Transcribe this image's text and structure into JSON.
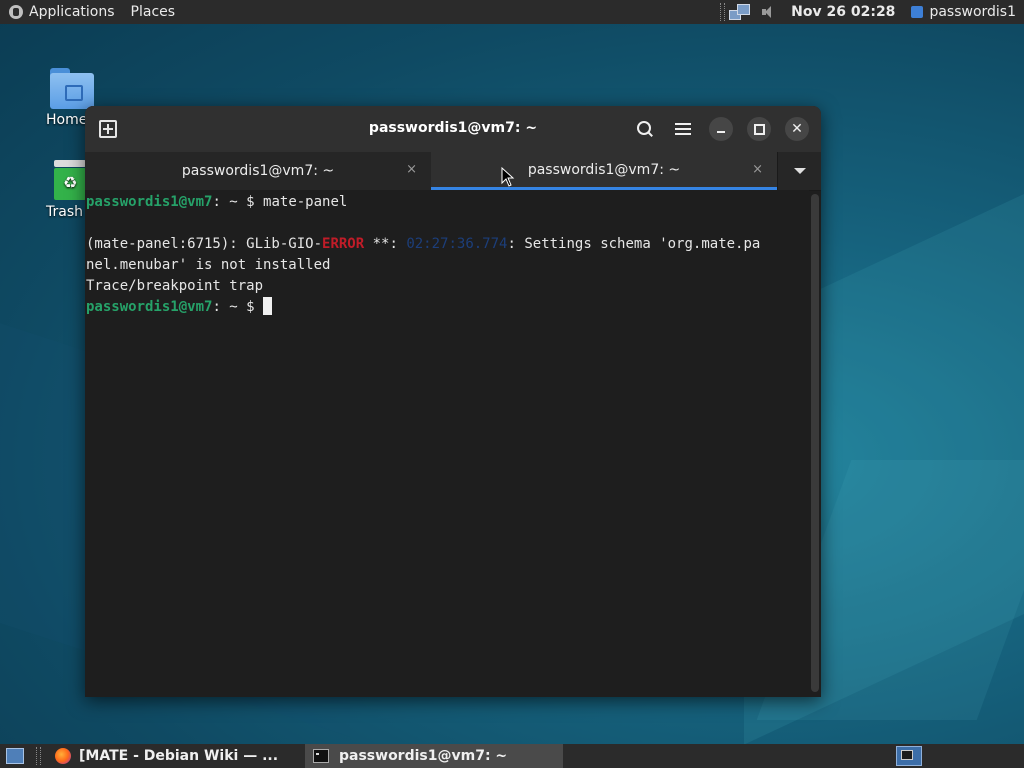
{
  "top_panel": {
    "applications_label": "Applications",
    "places_label": "Places",
    "clock": "Nov 26 02:28",
    "user": "passwordis1"
  },
  "desktop": {
    "icons": [
      {
        "label": "Home",
        "icon": "home-folder-icon"
      },
      {
        "label": "Trash",
        "icon": "trash-icon"
      }
    ]
  },
  "window": {
    "title": "passwordis1@vm7: ~",
    "tabs": [
      {
        "label": "passwordis1@vm7: ~",
        "active": false
      },
      {
        "label": "passwordis1@vm7: ~",
        "active": true
      }
    ],
    "tab_close_glyph": "×",
    "terminal": {
      "prompt_user": "passwordis1@vm7",
      "prompt_sep": ":",
      "prompt_path": " ~ $ ",
      "command": "mate-panel",
      "error_prefix": "(mate-panel:6715): GLib-GIO-",
      "error_word": "ERROR",
      "error_stars": " **: ",
      "error_timestamp": "02:27:36.774",
      "error_msg_1": ": Settings schema 'org.mate.pa",
      "error_msg_2": "nel.menubar' is not installed",
      "trace": "Trace/breakpoint trap"
    }
  },
  "taskbar": {
    "tasks": [
      {
        "label": "[MATE - Debian Wiki — ...",
        "icon": "firefox-icon"
      },
      {
        "label": "passwordis1@vm7: ~",
        "icon": "terminal-icon"
      }
    ]
  },
  "colors": {
    "prompt": "#26a269",
    "error": "#c01c28",
    "timestamp": "#1c3e7a",
    "accent": "#3584e4"
  }
}
